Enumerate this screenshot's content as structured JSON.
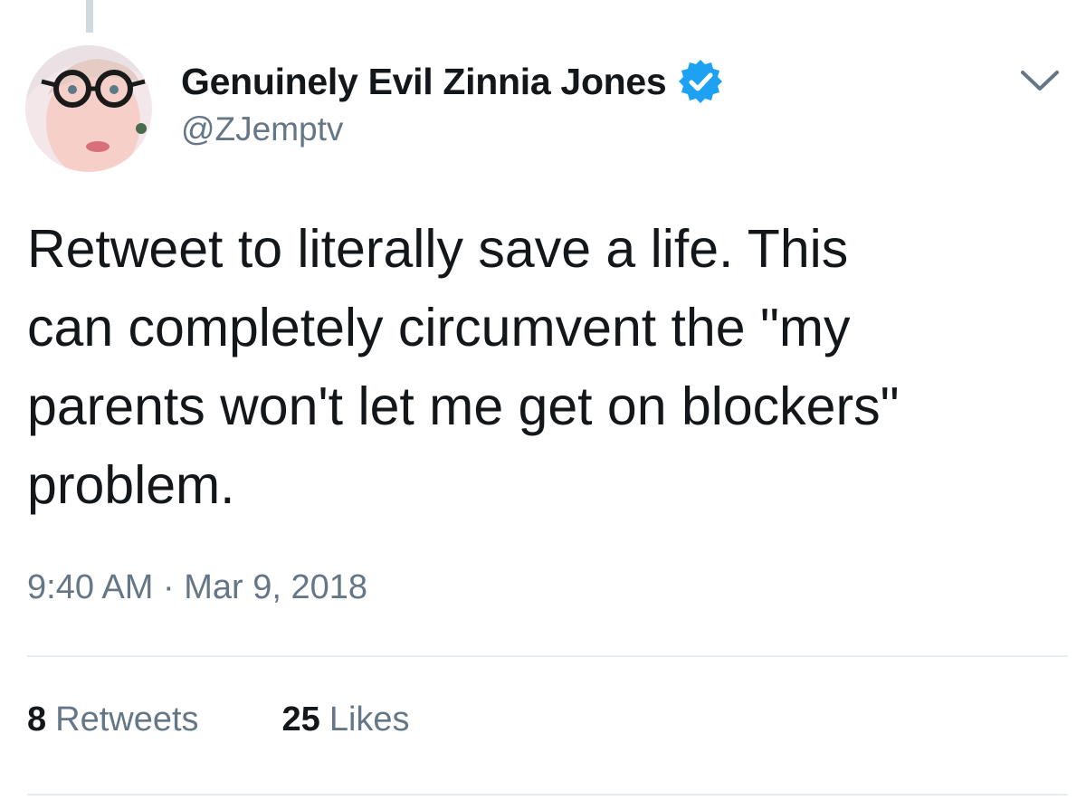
{
  "tweet": {
    "author": {
      "display_name": "Genuinely Evil Zinnia Jones",
      "handle": "@ZJemptv",
      "verified": true,
      "avatar_icon": "profile-photo"
    },
    "menu_icon": "chevron-down-icon",
    "text": "Retweet to literally save a life. This\ncan completely circumvent the \"my\nparents won't let me get on blockers\"\nproblem.",
    "timestamp": "9:40 AM · Mar 9, 2018",
    "stats": {
      "retweets": {
        "count": "8",
        "label": "Retweets"
      },
      "likes": {
        "count": "25",
        "label": "Likes"
      }
    }
  },
  "colors": {
    "text": "#14171a",
    "secondary": "#657786",
    "verified": "#1da1f2",
    "divider": "#e6ecf0"
  }
}
